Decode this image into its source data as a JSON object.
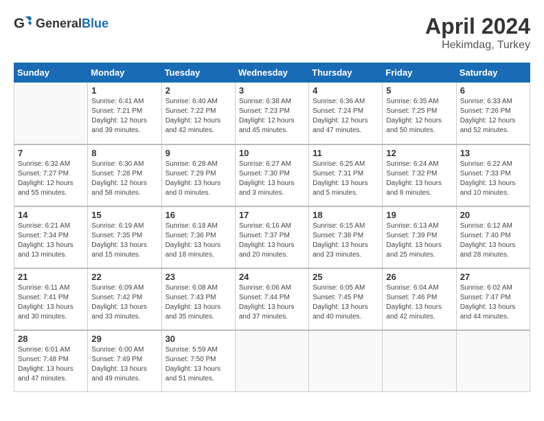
{
  "header": {
    "logo_general": "General",
    "logo_blue": "Blue",
    "title": "April 2024",
    "subtitle": "Hekimdag, Turkey"
  },
  "weekdays": [
    "Sunday",
    "Monday",
    "Tuesday",
    "Wednesday",
    "Thursday",
    "Friday",
    "Saturday"
  ],
  "weeks": [
    [
      {
        "day": "",
        "sunrise": "",
        "sunset": "",
        "daylight": ""
      },
      {
        "day": "1",
        "sunrise": "Sunrise: 6:41 AM",
        "sunset": "Sunset: 7:21 PM",
        "daylight": "Daylight: 12 hours and 39 minutes."
      },
      {
        "day": "2",
        "sunrise": "Sunrise: 6:40 AM",
        "sunset": "Sunset: 7:22 PM",
        "daylight": "Daylight: 12 hours and 42 minutes."
      },
      {
        "day": "3",
        "sunrise": "Sunrise: 6:38 AM",
        "sunset": "Sunset: 7:23 PM",
        "daylight": "Daylight: 12 hours and 45 minutes."
      },
      {
        "day": "4",
        "sunrise": "Sunrise: 6:36 AM",
        "sunset": "Sunset: 7:24 PM",
        "daylight": "Daylight: 12 hours and 47 minutes."
      },
      {
        "day": "5",
        "sunrise": "Sunrise: 6:35 AM",
        "sunset": "Sunset: 7:25 PM",
        "daylight": "Daylight: 12 hours and 50 minutes."
      },
      {
        "day": "6",
        "sunrise": "Sunrise: 6:33 AM",
        "sunset": "Sunset: 7:26 PM",
        "daylight": "Daylight: 12 hours and 52 minutes."
      }
    ],
    [
      {
        "day": "7",
        "sunrise": "Sunrise: 6:32 AM",
        "sunset": "Sunset: 7:27 PM",
        "daylight": "Daylight: 12 hours and 55 minutes."
      },
      {
        "day": "8",
        "sunrise": "Sunrise: 6:30 AM",
        "sunset": "Sunset: 7:28 PM",
        "daylight": "Daylight: 12 hours and 58 minutes."
      },
      {
        "day": "9",
        "sunrise": "Sunrise: 6:28 AM",
        "sunset": "Sunset: 7:29 PM",
        "daylight": "Daylight: 13 hours and 0 minutes."
      },
      {
        "day": "10",
        "sunrise": "Sunrise: 6:27 AM",
        "sunset": "Sunset: 7:30 PM",
        "daylight": "Daylight: 13 hours and 3 minutes."
      },
      {
        "day": "11",
        "sunrise": "Sunrise: 6:25 AM",
        "sunset": "Sunset: 7:31 PM",
        "daylight": "Daylight: 13 hours and 5 minutes."
      },
      {
        "day": "12",
        "sunrise": "Sunrise: 6:24 AM",
        "sunset": "Sunset: 7:32 PM",
        "daylight": "Daylight: 13 hours and 8 minutes."
      },
      {
        "day": "13",
        "sunrise": "Sunrise: 6:22 AM",
        "sunset": "Sunset: 7:33 PM",
        "daylight": "Daylight: 13 hours and 10 minutes."
      }
    ],
    [
      {
        "day": "14",
        "sunrise": "Sunrise: 6:21 AM",
        "sunset": "Sunset: 7:34 PM",
        "daylight": "Daylight: 13 hours and 13 minutes."
      },
      {
        "day": "15",
        "sunrise": "Sunrise: 6:19 AM",
        "sunset": "Sunset: 7:35 PM",
        "daylight": "Daylight: 13 hours and 15 minutes."
      },
      {
        "day": "16",
        "sunrise": "Sunrise: 6:18 AM",
        "sunset": "Sunset: 7:36 PM",
        "daylight": "Daylight: 13 hours and 18 minutes."
      },
      {
        "day": "17",
        "sunrise": "Sunrise: 6:16 AM",
        "sunset": "Sunset: 7:37 PM",
        "daylight": "Daylight: 13 hours and 20 minutes."
      },
      {
        "day": "18",
        "sunrise": "Sunrise: 6:15 AM",
        "sunset": "Sunset: 7:38 PM",
        "daylight": "Daylight: 13 hours and 23 minutes."
      },
      {
        "day": "19",
        "sunrise": "Sunrise: 6:13 AM",
        "sunset": "Sunset: 7:39 PM",
        "daylight": "Daylight: 13 hours and 25 minutes."
      },
      {
        "day": "20",
        "sunrise": "Sunrise: 6:12 AM",
        "sunset": "Sunset: 7:40 PM",
        "daylight": "Daylight: 13 hours and 28 minutes."
      }
    ],
    [
      {
        "day": "21",
        "sunrise": "Sunrise: 6:11 AM",
        "sunset": "Sunset: 7:41 PM",
        "daylight": "Daylight: 13 hours and 30 minutes."
      },
      {
        "day": "22",
        "sunrise": "Sunrise: 6:09 AM",
        "sunset": "Sunset: 7:42 PM",
        "daylight": "Daylight: 13 hours and 33 minutes."
      },
      {
        "day": "23",
        "sunrise": "Sunrise: 6:08 AM",
        "sunset": "Sunset: 7:43 PM",
        "daylight": "Daylight: 13 hours and 35 minutes."
      },
      {
        "day": "24",
        "sunrise": "Sunrise: 6:06 AM",
        "sunset": "Sunset: 7:44 PM",
        "daylight": "Daylight: 13 hours and 37 minutes."
      },
      {
        "day": "25",
        "sunrise": "Sunrise: 6:05 AM",
        "sunset": "Sunset: 7:45 PM",
        "daylight": "Daylight: 13 hours and 40 minutes."
      },
      {
        "day": "26",
        "sunrise": "Sunrise: 6:04 AM",
        "sunset": "Sunset: 7:46 PM",
        "daylight": "Daylight: 13 hours and 42 minutes."
      },
      {
        "day": "27",
        "sunrise": "Sunrise: 6:02 AM",
        "sunset": "Sunset: 7:47 PM",
        "daylight": "Daylight: 13 hours and 44 minutes."
      }
    ],
    [
      {
        "day": "28",
        "sunrise": "Sunrise: 6:01 AM",
        "sunset": "Sunset: 7:48 PM",
        "daylight": "Daylight: 13 hours and 47 minutes."
      },
      {
        "day": "29",
        "sunrise": "Sunrise: 6:00 AM",
        "sunset": "Sunset: 7:49 PM",
        "daylight": "Daylight: 13 hours and 49 minutes."
      },
      {
        "day": "30",
        "sunrise": "Sunrise: 5:59 AM",
        "sunset": "Sunset: 7:50 PM",
        "daylight": "Daylight: 13 hours and 51 minutes."
      },
      {
        "day": "",
        "sunrise": "",
        "sunset": "",
        "daylight": ""
      },
      {
        "day": "",
        "sunrise": "",
        "sunset": "",
        "daylight": ""
      },
      {
        "day": "",
        "sunrise": "",
        "sunset": "",
        "daylight": ""
      },
      {
        "day": "",
        "sunrise": "",
        "sunset": "",
        "daylight": ""
      }
    ]
  ]
}
